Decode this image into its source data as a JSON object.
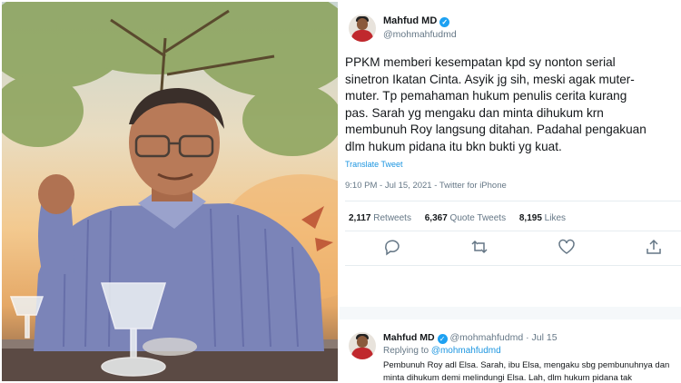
{
  "tweet": {
    "author_name": "Mahfud MD",
    "author_handle": "@mohmahfudmd",
    "text_lines": [
      "PPKM memberi kesempatan kpd sy nonton serial",
      "sinetron Ikatan Cinta. Asyik jg sih, meski agak muter-",
      "muter. Tp pemahaman hukum penulis cerita kurang",
      "pas. Sarah yg mengaku dan minta dihukum krn",
      "membunuh Roy langsung ditahan. Padahal pengakuan",
      "dlm hukum pidana itu bkn bukti yg kuat."
    ],
    "translate_label": "Translate Tweet",
    "timestamp": "9:10 PM - Jul 15, 2021 - Twitter for iPhone",
    "retweets_count": "2,117",
    "retweets_label": "Retweets",
    "quote_count": "6,367",
    "quote_label": "Quote Tweets",
    "likes_count": "8,195",
    "likes_label": "Likes",
    "actions": [
      "reply-icon",
      "retweet-icon",
      "like-icon",
      "share-icon"
    ]
  },
  "reply": {
    "author_name": "Mahfud MD",
    "author_handle": "@mohmahfudmd",
    "date": "Jul 15",
    "replying_prefix": "Replying to",
    "replying_to": "@mohmahfudmd",
    "text_lines": [
      "Pembunuh Roy adl Elsa. Sarah, ibu Elsa, mengaku sbg pembunuhnya dan",
      "minta dihukum demi melindungi Elsa. Lah, dlm hukum pidana tak"
    ]
  },
  "colors": {
    "accent": "#1da1f2",
    "link": "#1b95e0",
    "muted": "#657786",
    "text": "#14171a"
  }
}
